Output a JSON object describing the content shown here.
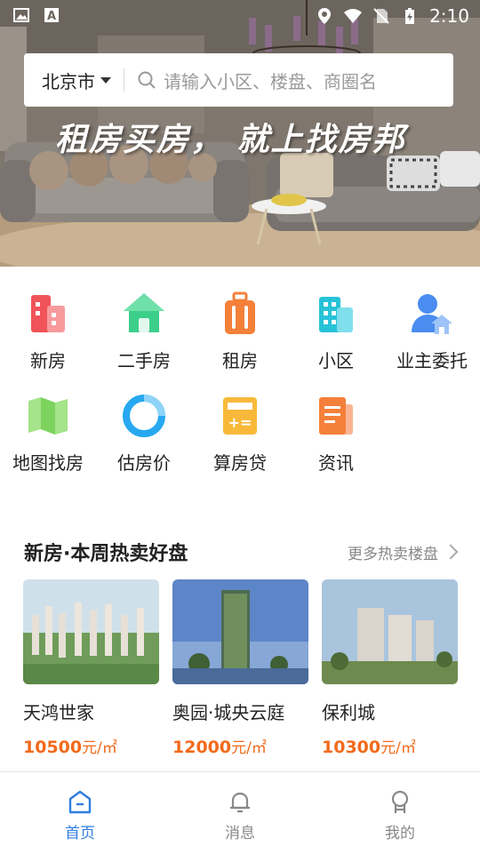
{
  "status_bar": {
    "time": "2:10",
    "icons": [
      "image-icon",
      "a-icon",
      "location-icon",
      "wifi-icon",
      "no-sim-icon",
      "battery-charging-icon"
    ]
  },
  "search": {
    "city": "北京市",
    "placeholder": "请输入小区、楼盘、商圈名"
  },
  "banner": {
    "slogan": "租房买房， 就上找房邦"
  },
  "categories": [
    {
      "label": "新房",
      "icon": "new-house-icon",
      "color": "#f0545a"
    },
    {
      "label": "二手房",
      "icon": "second-hand-house-icon",
      "color": "#3ccf8a"
    },
    {
      "label": "租房",
      "icon": "rent-suitcase-icon",
      "color": "#f4803a"
    },
    {
      "label": "小区",
      "icon": "community-buildings-icon",
      "color": "#27c2d8"
    },
    {
      "label": "业主委托",
      "icon": "owner-entrust-icon",
      "color": "#4a8cf0"
    },
    {
      "label": "地图找房",
      "icon": "map-icon",
      "color": "#7cd35d"
    },
    {
      "label": "估房价",
      "icon": "valuation-pie-icon",
      "color": "#27a8f0"
    },
    {
      "label": "算房贷",
      "icon": "calculator-icon",
      "color": "#f8b93a"
    },
    {
      "label": "资讯",
      "icon": "news-document-icon",
      "color": "#f4803a"
    }
  ],
  "hot_section": {
    "title": "新房·本周热卖好盘",
    "more": "更多热卖楼盘",
    "items": [
      {
        "name": "天鸿世家",
        "price": "10500",
        "unit": "元/㎡"
      },
      {
        "name": "奥园·城央云庭",
        "price": "12000",
        "unit": "元/㎡"
      },
      {
        "name": "保利城",
        "price": "10300",
        "unit": "元/㎡"
      }
    ]
  },
  "tabs": [
    {
      "label": "首页",
      "icon": "home-icon",
      "active": true
    },
    {
      "label": "消息",
      "icon": "bell-icon",
      "active": false
    },
    {
      "label": "我的",
      "icon": "profile-icon",
      "active": false
    }
  ],
  "colors": {
    "accent": "#2f7de1",
    "price": "#f26a1b"
  }
}
